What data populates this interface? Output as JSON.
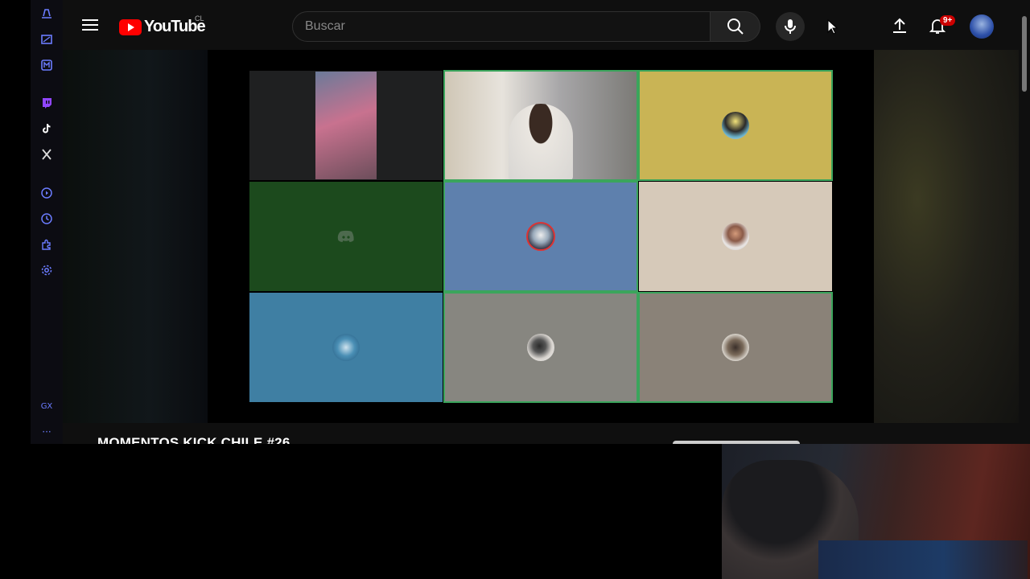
{
  "youtube": {
    "logo_text": "YouTube",
    "country_code": "CL",
    "search_placeholder": "Buscar",
    "notification_count": "9+"
  },
  "sidebar": {
    "gx_label": "GX",
    "more_label": "···",
    "icons": [
      "gx-home-icon",
      "gx-image-icon",
      "messenger-icon",
      "twitch-icon",
      "tiktok-icon",
      "x-icon",
      "player-icon",
      "history-icon",
      "extensions-icon",
      "settings-icon"
    ]
  },
  "video": {
    "title": "MOMENTOS KICK CHILE #26",
    "call_tiles": [
      {
        "color": "#1f2021",
        "kind": "camera"
      },
      {
        "color": "#8d8a82",
        "kind": "camera"
      },
      {
        "color": "#c9b455",
        "kind": "avatar"
      },
      {
        "color": "#1c4a1d",
        "kind": "discord"
      },
      {
        "color": "#5e80ad",
        "kind": "avatar"
      },
      {
        "color": "#d6c9b9",
        "kind": "avatar"
      },
      {
        "color": "#3f7fa3",
        "kind": "avatar"
      },
      {
        "color": "#878680",
        "kind": "avatar"
      },
      {
        "color": "#8a8278",
        "kind": "avatar"
      }
    ]
  }
}
